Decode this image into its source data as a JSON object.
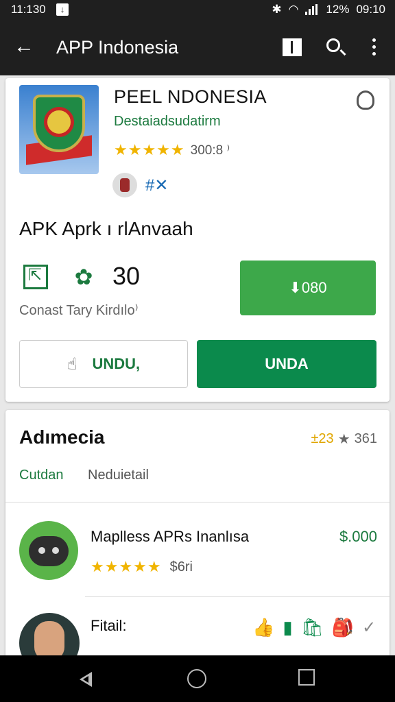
{
  "status": {
    "time": "11:130",
    "download": "↓",
    "right": "12%",
    "time_right": "09:10"
  },
  "appbar": {
    "back": "←",
    "title": "APP  Indonesia"
  },
  "app": {
    "title": "PEEL  NDONESIA",
    "developer": "Destaiadsudatirm",
    "stars": "★★★★★",
    "rating_count": "300:8 ⁾",
    "tags": "#✕"
  },
  "section_title": "APK Aprk ı rlAnvaah",
  "stats": {
    "count": "30",
    "sub_text": "Conast Tary Kirdılo⁾",
    "price_button": "⬇080"
  },
  "buttons": {
    "outline_label": "UNDU,",
    "outline_icon": "☝",
    "fill_label": "UNDA"
  },
  "card2": {
    "title": "Adımecia",
    "rating": "±23",
    "rating_star": "★",
    "rating_count": "361",
    "tab_active": "Cutdan",
    "tab": "Neduietail"
  },
  "list": [
    {
      "title": "Maplless APRs Inanlısa",
      "price": "$.000",
      "stars": "★★★★★",
      "count": "$6ri"
    },
    {
      "title": "Fitail:",
      "icons": [
        "👍",
        "▮",
        "🛍",
        "🎒"
      ],
      "check": "✓"
    }
  ]
}
